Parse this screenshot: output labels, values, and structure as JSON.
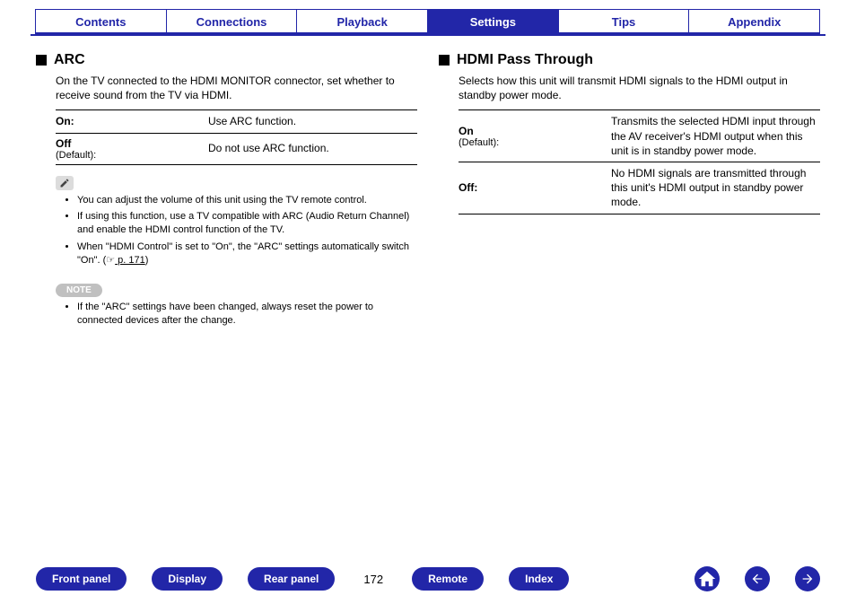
{
  "tabs": {
    "contents": "Contents",
    "connections": "Connections",
    "playback": "Playback",
    "settings": "Settings",
    "tips": "Tips",
    "appendix": "Appendix"
  },
  "arc": {
    "title": "ARC",
    "intro": "On the TV connected to the HDMI MONITOR connector, set whether to receive sound from the TV via HDMI.",
    "rows": [
      {
        "label": "On:",
        "sub": "",
        "desc": "Use ARC function."
      },
      {
        "label": "Off",
        "sub": "(Default):",
        "desc": "Do not use ARC function."
      }
    ],
    "tips": [
      "You can adjust the volume of this unit using the TV remote control.",
      "If using this function, use a TV compatible with ARC (Audio Return Channel) and enable the HDMI control function of the TV.",
      "When \"HDMI Control\" is set to \"On\", the \"ARC\" settings automatically switch \"On\".  (☞"
    ],
    "tiplink": " p. 171",
    "tipend": ")",
    "note_label": "NOTE",
    "notes": [
      "If the \"ARC\" settings have been changed, always reset the power to connected devices after the change."
    ]
  },
  "hdmi": {
    "title": "HDMI Pass Through",
    "intro": "Selects how this unit will transmit HDMI signals to the HDMI output in standby power mode.",
    "rows": [
      {
        "label": "On",
        "sub": "(Default):",
        "desc": "Transmits the selected HDMI input through the AV receiver's HDMI output when this unit is in standby power mode."
      },
      {
        "label": "Off:",
        "sub": "",
        "desc": "No HDMI signals are transmitted through this unit's HDMI output in standby power mode."
      }
    ]
  },
  "bottom": {
    "front": "Front panel",
    "display": "Display",
    "rear": "Rear panel",
    "remote": "Remote",
    "index": "Index",
    "page": "172"
  }
}
